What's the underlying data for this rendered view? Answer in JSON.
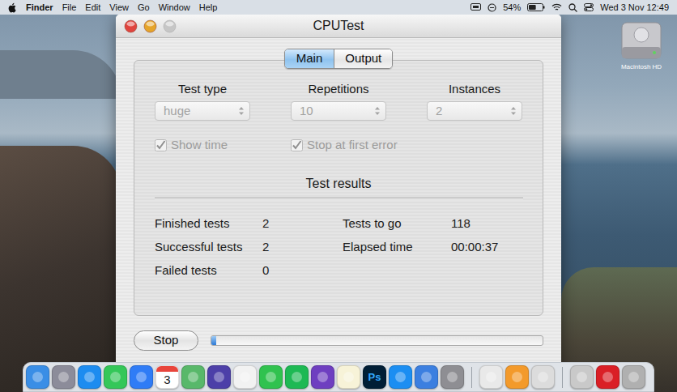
{
  "menu_bar": {
    "app": "Finder",
    "menus": [
      "File",
      "Edit",
      "View",
      "Go",
      "Window",
      "Help"
    ],
    "battery": "54%",
    "battery_level": 0.54,
    "clock": "Wed 3 Nov 12:49"
  },
  "desktop_icons": [
    {
      "label": "Macintosh HD"
    }
  ],
  "window": {
    "title": "CPUTest",
    "controls": [
      {
        "kind": "close",
        "disabled": false
      },
      {
        "kind": "minimize",
        "disabled": false
      },
      {
        "kind": "zoom",
        "disabled": true
      }
    ]
  },
  "tabs": [
    {
      "label": "Main",
      "selected": true
    },
    {
      "label": "Output",
      "selected": false
    }
  ],
  "settings": [
    {
      "label": "Test type",
      "value": "huge",
      "disabled": true
    },
    {
      "label": "Repetitions",
      "value": "10",
      "disabled": true
    },
    {
      "label": "Instances",
      "value": "2",
      "disabled": true
    }
  ],
  "checkboxes": [
    {
      "label": "Show time",
      "checked": true,
      "disabled": true
    },
    {
      "label": "Stop at first error",
      "checked": true,
      "disabled": true
    }
  ],
  "results": {
    "title": "Test results",
    "left": [
      {
        "label": "Finished tests",
        "value": "2"
      },
      {
        "label": "Successful tests",
        "value": "2"
      },
      {
        "label": "Failed tests",
        "value": "0"
      }
    ],
    "right": [
      {
        "label": "Tests to go",
        "value": "118"
      },
      {
        "label": "Elapsed time",
        "value": "00:00:37"
      }
    ]
  },
  "stop_button": {
    "label": "Stop"
  },
  "progress": {
    "level": 0.015
  },
  "dock": {
    "items": [
      {
        "kind": "app",
        "color": "#3a8ee6"
      },
      {
        "kind": "app",
        "color": "#8c8c9a"
      },
      {
        "kind": "app",
        "color": "#1d8cf0"
      },
      {
        "kind": "app",
        "color": "#34c759"
      },
      {
        "kind": "app",
        "color": "#2f7cf6"
      },
      {
        "kind": "app",
        "color": "#ffffff",
        "glyph": "3"
      },
      {
        "kind": "app",
        "color": "#58b86a"
      },
      {
        "kind": "app",
        "color": "#4c3fa8"
      },
      {
        "kind": "app",
        "color": "#f2f2f2"
      },
      {
        "kind": "app",
        "color": "#30c24f"
      },
      {
        "kind": "app",
        "color": "#1db954"
      },
      {
        "kind": "app",
        "color": "#6e3fc0"
      },
      {
        "kind": "app",
        "color": "#f7f3d8"
      },
      {
        "kind": "app",
        "color": "#001e36",
        "glyph": "Ps"
      },
      {
        "kind": "app",
        "color": "#1b8ef2"
      },
      {
        "kind": "app",
        "color": "#3b7fe0"
      },
      {
        "kind": "app",
        "color": "#8e8e93"
      },
      {
        "kind": "separator"
      },
      {
        "kind": "app",
        "color": "#e9e9e9"
      },
      {
        "kind": "app",
        "color": "#f39a2b"
      },
      {
        "kind": "app",
        "color": "#dcdcdc"
      },
      {
        "kind": "separator"
      },
      {
        "kind": "app",
        "color": "#c9c9c9"
      },
      {
        "kind": "app",
        "color": "#da1f26"
      },
      {
        "kind": "app",
        "color": "#b0b0b0"
      }
    ]
  }
}
